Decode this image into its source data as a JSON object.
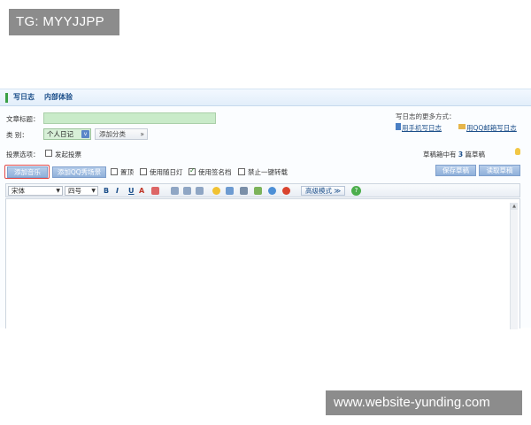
{
  "watermarks": {
    "top": "TG: MYYJJPP",
    "bottom": "www.website-yunding.com"
  },
  "header": {
    "tab_write": "写日志",
    "tab_internal": "内部体验"
  },
  "form": {
    "title_label": "文章标题：",
    "category_label": "类    别：",
    "category_value": "个人日记",
    "add_category_label": "添加分类",
    "add_category_icon": "double-chevron-right-icon",
    "vote_label": "投票选项：",
    "vote_checkbox_label": "发起投票"
  },
  "more_ways": {
    "label": "写日志的更多方式：",
    "mobile_link": "用手机写日志",
    "qqmail_link": "用QQ邮箱写日志"
  },
  "draft": {
    "prefix": "草稿箱中有",
    "count": "3",
    "suffix": "篇草稿"
  },
  "actions": {
    "add_music": "添加音乐",
    "add_video": "添加QQ秀场景",
    "save_draft": "保存草稿",
    "read_draft": "读取草稿"
  },
  "options": [
    {
      "label": "置顶",
      "checked": false
    },
    {
      "label": "使用随日灯",
      "checked": false
    },
    {
      "label": "使用签名档",
      "checked": true
    },
    {
      "label": "禁止一键转载",
      "checked": false
    }
  ],
  "toolbar": {
    "font_family": "宋体",
    "font_size": "四号",
    "bold": "B",
    "italic": "I",
    "underline": "U",
    "font_color": "A",
    "advanced_mode": "高级模式 ≫",
    "help": "?"
  },
  "colors": {
    "accent": "#1c4f8a",
    "title_field": "#c9ebc9",
    "button_blue": "#8fb0da",
    "highlight_red": "#e04a4a"
  }
}
